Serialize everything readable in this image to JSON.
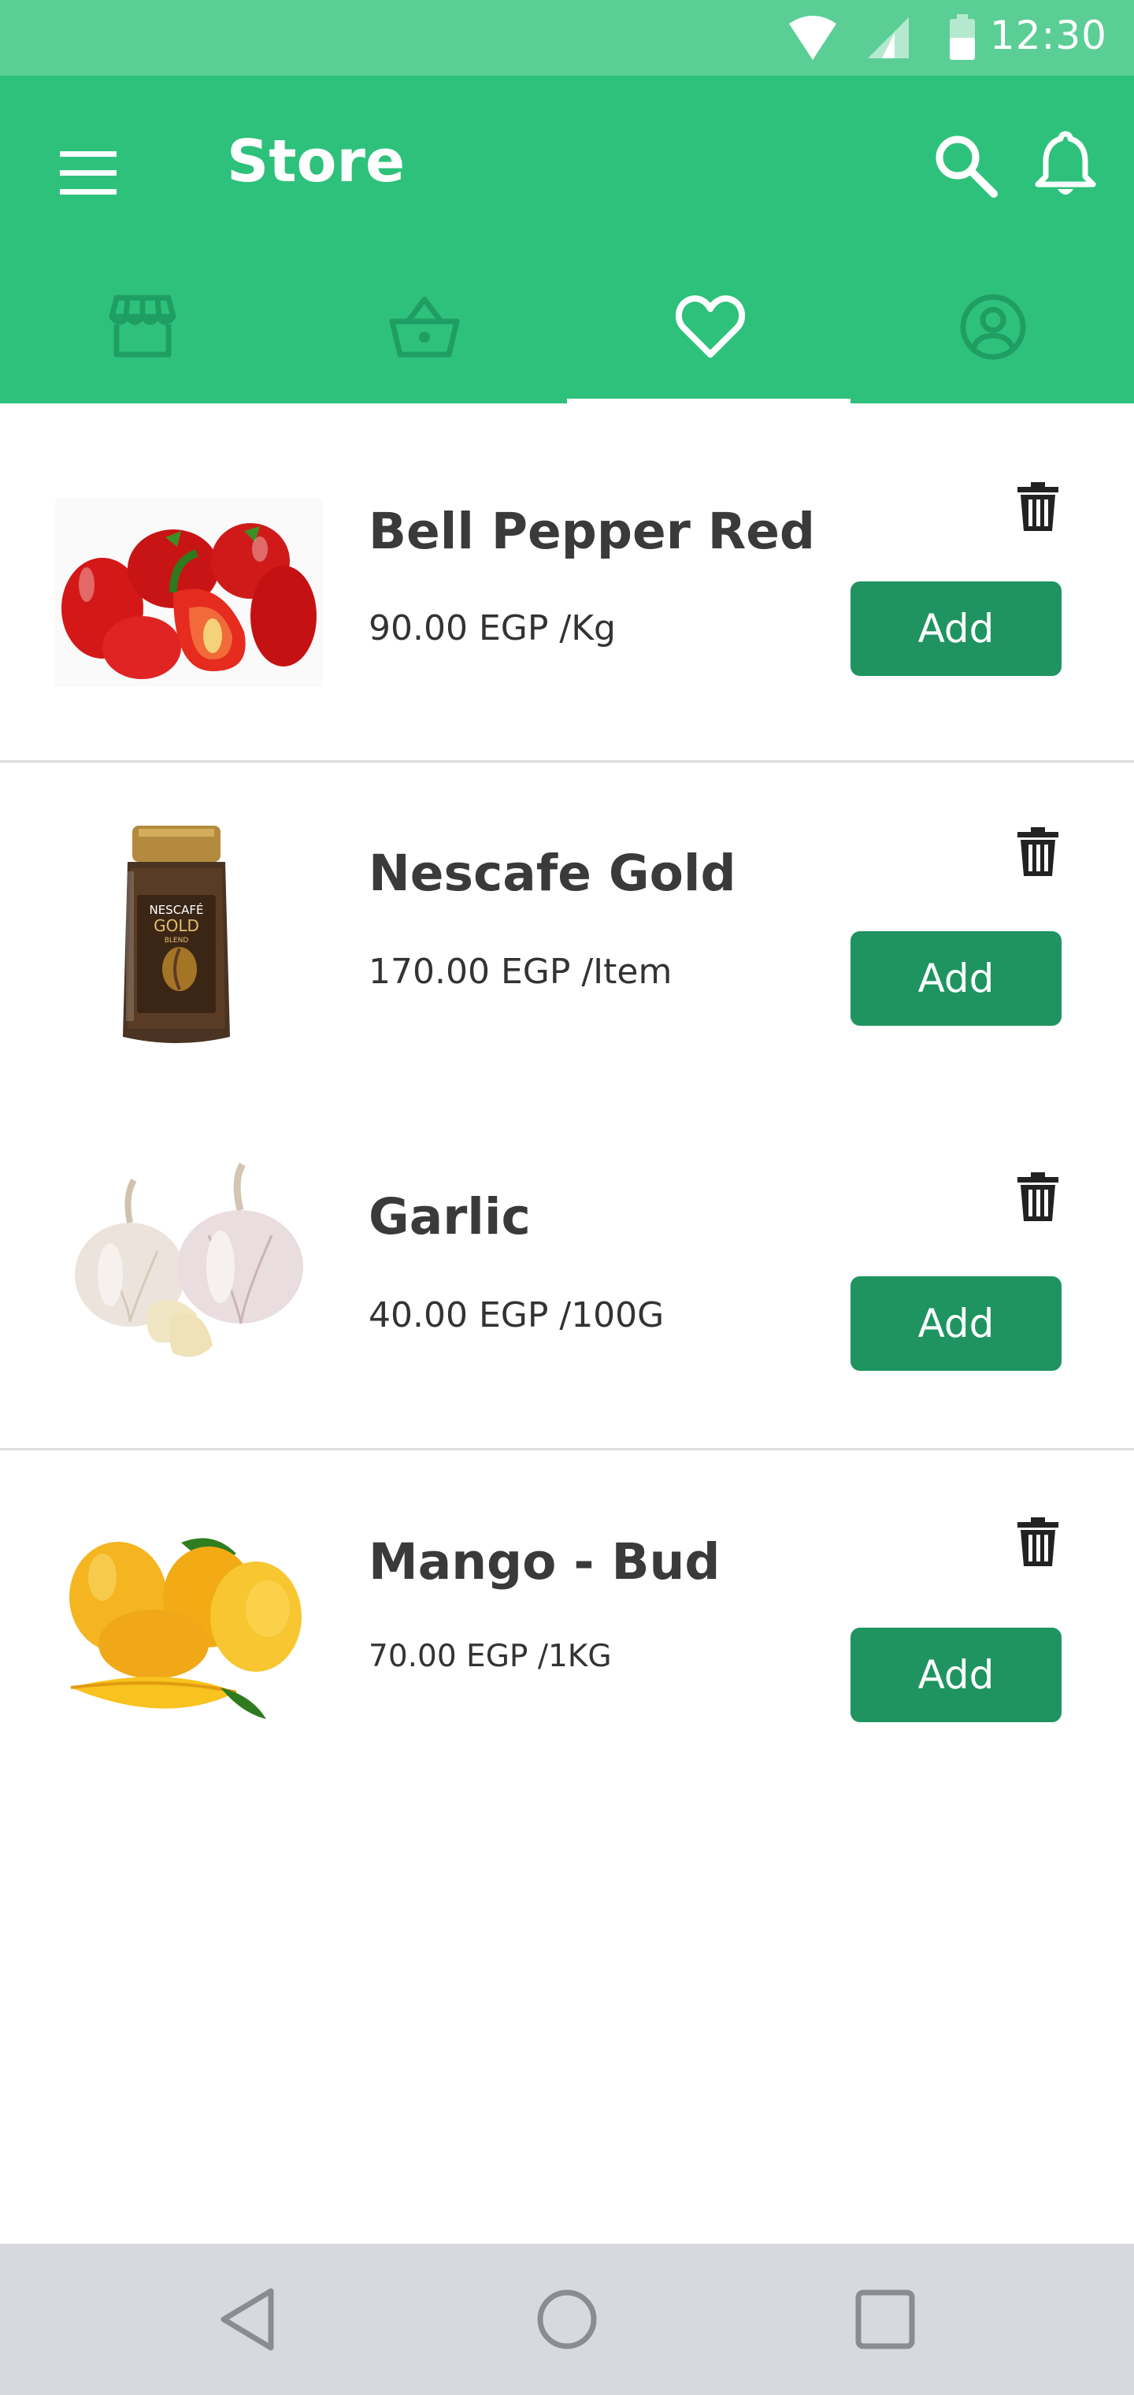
{
  "status_bar": {
    "time": "12:30",
    "icons": [
      "wifi-icon",
      "signal-icon",
      "battery-icon"
    ]
  },
  "app_bar": {
    "title": "Store",
    "left_icon": "menu-icon",
    "right_icons": [
      "search-icon",
      "bell-icon"
    ]
  },
  "tabs": [
    {
      "icon": "storefront-icon",
      "active": false
    },
    {
      "icon": "basket-icon",
      "active": false
    },
    {
      "icon": "heart-icon",
      "active": true
    },
    {
      "icon": "account-circle-icon",
      "active": false
    }
  ],
  "items": [
    {
      "name": "Bell Pepper Red",
      "price": "90.00 EGP /Kg",
      "add_label": "Add"
    },
    {
      "name": "Nescafe Gold",
      "price": "170.00 EGP /Item",
      "add_label": "Add"
    },
    {
      "name": "Garlic",
      "price": "40.00 EGP /100G",
      "add_label": "Add"
    },
    {
      "name": "Mango - Bud",
      "price": "70.00 EGP /1KG",
      "add_label": "Add"
    }
  ],
  "jar_label": {
    "brand": "NESCAFÉ",
    "product": "GOLD",
    "sub": "BLEND"
  },
  "colors": {
    "status_bar": "#5bce95",
    "app_bar": "#2ec17c",
    "add_button": "#1f9460",
    "inactive_tab_icon": "#1f9e63",
    "nav_bar": "#d8d9de"
  },
  "nav_bar": {
    "icons": [
      "back-icon",
      "home-icon",
      "recents-icon"
    ]
  }
}
